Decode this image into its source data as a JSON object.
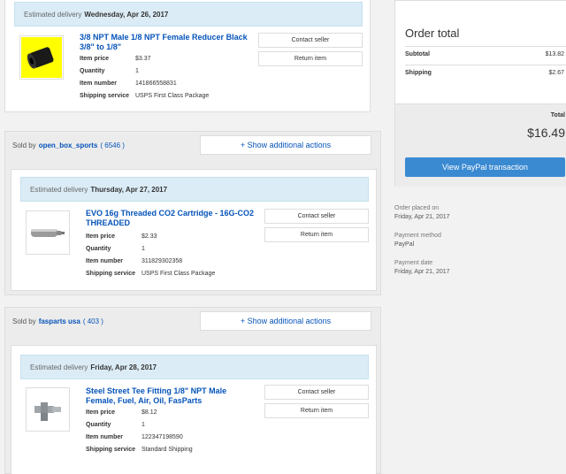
{
  "orders": [
    {
      "seller": null,
      "delivery_label": "Estimated delivery",
      "delivery_date": "Wednesday, Apr 26, 2017",
      "title": "3/8 NPT Male 1/8 NPT Female Reducer Black 3/8\" to 1/8\"",
      "price_label": "Item price",
      "price": "$3.37",
      "qty_label": "Quantity",
      "qty": "1",
      "num_label": "Item number",
      "num": "141866558831",
      "ship_label": "Shipping service",
      "ship": "USPS First Class Package",
      "contact": "Contact seller",
      "return": "Return item"
    },
    {
      "seller_prefix": "Sold by",
      "seller": "open_box_sports",
      "seller_count": "( 6546 )",
      "show_actions": "+ Show additional actions",
      "delivery_label": "Estimated delivery",
      "delivery_date": "Thursday, Apr 27, 2017",
      "title": "EVO 16g Threaded CO2 Cartridge - 16G-CO2 THREADED",
      "price_label": "Item price",
      "price": "$2.33",
      "qty_label": "Quantity",
      "qty": "1",
      "num_label": "Item number",
      "num": "311829302358",
      "ship_label": "Shipping service",
      "ship": "USPS First Class Package",
      "contact": "Contact seller",
      "return": "Return item"
    },
    {
      "seller_prefix": "Sold by",
      "seller": "fasparts usa",
      "seller_count": "( 403 )",
      "show_actions": "+ Show additional actions",
      "delivery_label": "Estimated delivery",
      "delivery_date": "Friday, Apr 28, 2017",
      "title": "Steel Street Tee Fitting 1/8\" NPT Male Female, Fuel, Air, Oil, FasParts",
      "price_label": "Item price",
      "price": "$8.12",
      "qty_label": "Quantity",
      "qty": "1",
      "num_label": "Item number",
      "num": "122347198590",
      "ship_label": "Shipping service",
      "ship": "Standard Shipping",
      "contact": "Contact seller",
      "return": "Return item"
    }
  ],
  "summary": {
    "title": "Order total",
    "subtotal_label": "Subtotal",
    "subtotal": "$13.82",
    "shipping_label": "Shipping",
    "shipping": "$2.67",
    "total_label": "Total",
    "total": "$16.49",
    "paypal_button": "View PayPal transaction",
    "placed_label": "Order placed on",
    "placed": "Friday, Apr 21, 2017",
    "method_label": "Payment method",
    "method": "PayPal",
    "paydate_label": "Payment date",
    "paydate": "Friday, Apr 21, 2017"
  }
}
